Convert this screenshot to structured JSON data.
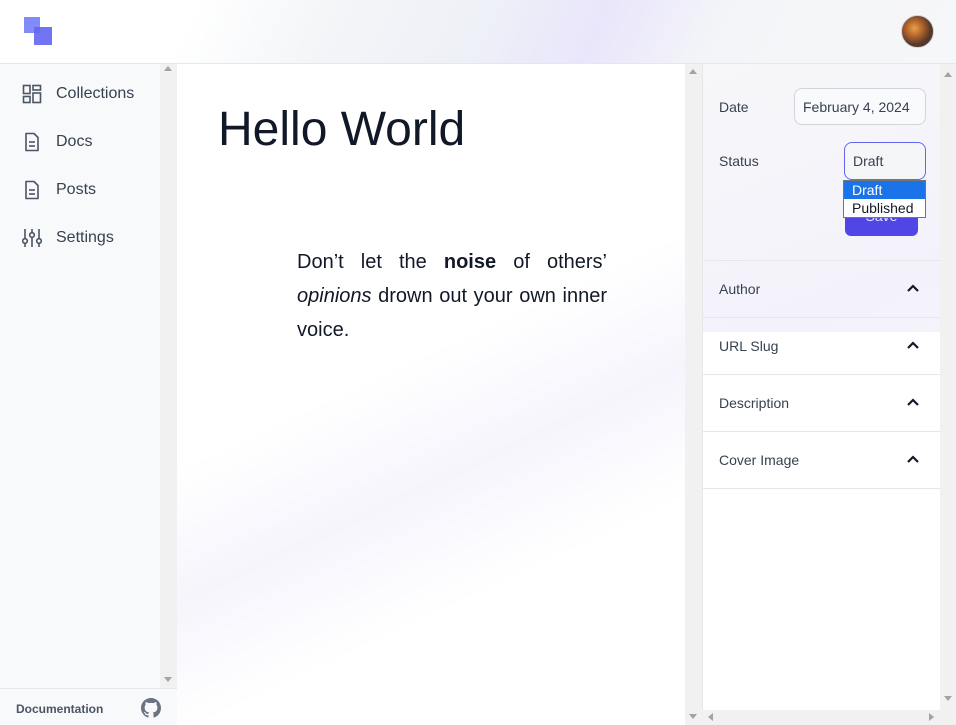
{
  "header": {
    "logo_icon": "logo-squares-icon",
    "avatar_icon": "user-avatar"
  },
  "sidebar": {
    "items": [
      {
        "label": "Collections",
        "icon": "collections-grid-icon"
      },
      {
        "label": "Docs",
        "icon": "document-icon"
      },
      {
        "label": "Posts",
        "icon": "document-icon"
      },
      {
        "label": "Settings",
        "icon": "sliders-icon"
      }
    ],
    "footer": {
      "documentation_label": "Documentation",
      "github_icon": "github-icon"
    }
  },
  "editor": {
    "title": "Hello World",
    "quote": {
      "part1": "Don’t let the ",
      "bold": "noise",
      "part2": " of others’ ",
      "italic": "opinions",
      "part3": " drown out your own inner voice."
    }
  },
  "panel": {
    "date_label": "Date",
    "date_value": "February 4, 2024",
    "status_label": "Status",
    "status_value": "Draft",
    "status_options": [
      "Draft",
      "Published"
    ],
    "save_label": "Save",
    "sections": [
      {
        "label": "Author"
      },
      {
        "label": "URL Slug"
      },
      {
        "label": "Description"
      },
      {
        "label": "Cover Image"
      }
    ]
  },
  "colors": {
    "accent": "#4f46e5",
    "logo": "#818cf8",
    "select_highlight": "#1a73e8"
  }
}
